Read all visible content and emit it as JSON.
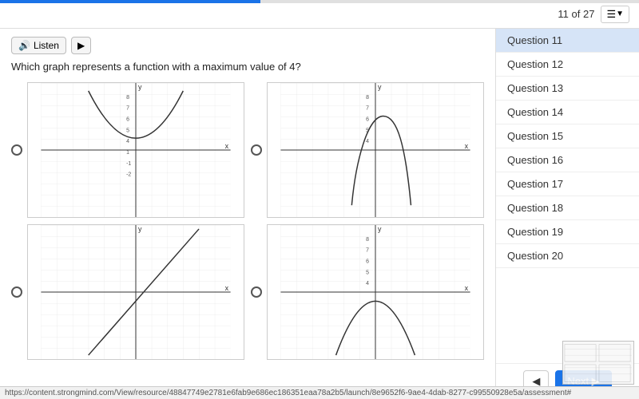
{
  "topBar": {
    "progress": "11 of 27",
    "progressPercent": 40.7
  },
  "listenBar": {
    "listenLabel": "Listen",
    "speakerIcon": "🔊"
  },
  "question": {
    "text": "Which graph represents a function with a maximum value of 4?"
  },
  "sidebar": {
    "items": [
      {
        "label": "Question 11",
        "active": true
      },
      {
        "label": "Question 12",
        "active": false
      },
      {
        "label": "Question 13",
        "active": false
      },
      {
        "label": "Question 14",
        "active": false
      },
      {
        "label": "Question 15",
        "active": false
      },
      {
        "label": "Question 16",
        "active": false
      },
      {
        "label": "Question 17",
        "active": false
      },
      {
        "label": "Question 18",
        "active": false
      },
      {
        "label": "Question 19",
        "active": false
      },
      {
        "label": "Question 20",
        "active": false
      }
    ],
    "prevLabel": "◀",
    "nextLabel": "Next ▶"
  },
  "statusBar": {
    "url": "https://content.strongmind.com/View/resource/48847749e2781e6fab9e686ec186351eaa78a2b5/launch/8e9652f6-9ae4-4dab-8277-c99550928e5a/assessment#"
  }
}
